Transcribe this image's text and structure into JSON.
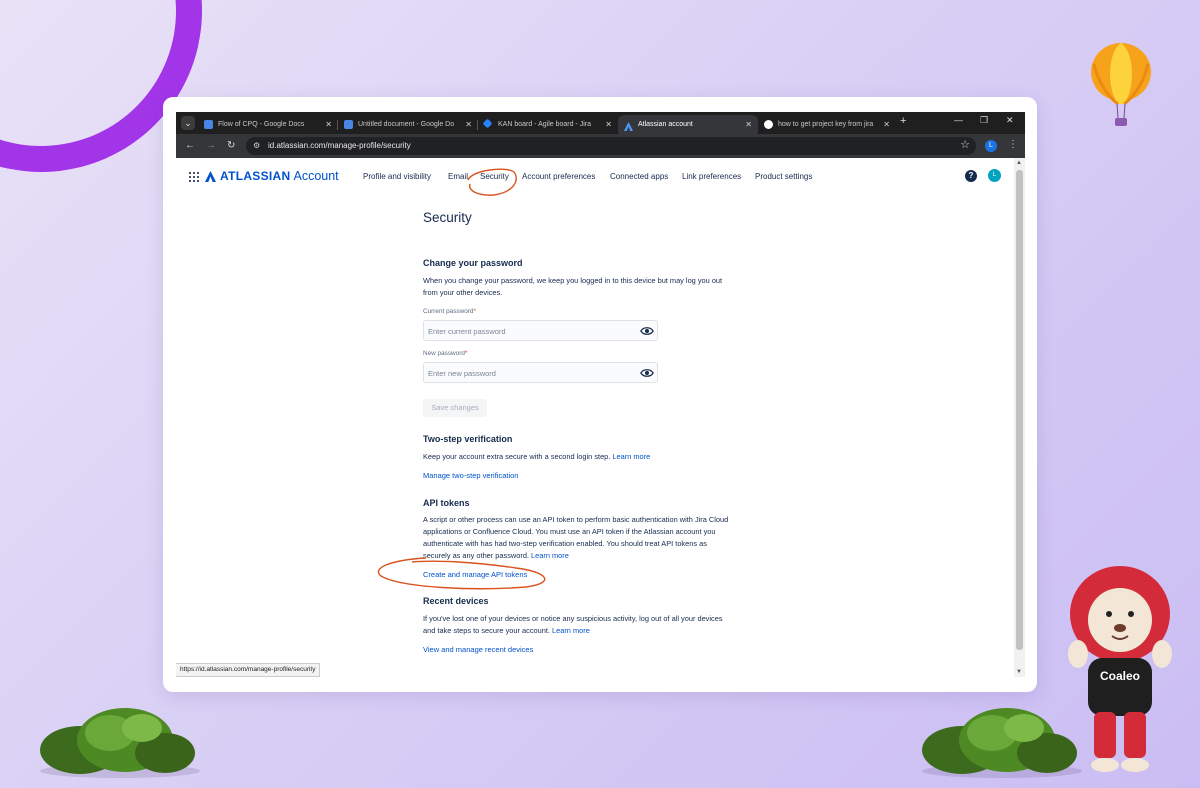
{
  "browser": {
    "tabs": [
      {
        "title": "Flow of CPQ - Google Docs",
        "icon": "google-docs-icon",
        "active": false
      },
      {
        "title": "Untitled document - Google Do",
        "icon": "google-docs-icon",
        "active": false
      },
      {
        "title": "KAN board - Agile board - Jira",
        "icon": "jira-icon",
        "active": false
      },
      {
        "title": "Atlassian account",
        "icon": "atlassian-icon",
        "active": true
      },
      {
        "title": "how to get project key from jira",
        "icon": "google-icon",
        "active": false
      }
    ],
    "url": "id.atlassian.com/manage-profile/security",
    "profile_initial": "L",
    "status_url": "https://id.atlassian.com/manage-profile/security"
  },
  "header": {
    "brand": "ATLASSIAN",
    "product": "Account",
    "nav": [
      "Profile and visibility",
      "Email",
      "Security",
      "Account preferences",
      "Connected apps",
      "Link preferences",
      "Product settings"
    ],
    "active_nav": "Security",
    "help": "?",
    "avatar_initial": "L"
  },
  "security": {
    "title": "Security",
    "password": {
      "heading": "Change your password",
      "desc_line1": "When you change your password, we keep you logged in to this device but may log you out",
      "desc_line2": "from your other devices.",
      "current_label": "Current password",
      "current_placeholder": "Enter current password",
      "new_label": "New password",
      "new_placeholder": "Enter new password",
      "required_mark": "*",
      "save_label": "Save changes"
    },
    "two_step": {
      "heading": "Two-step verification",
      "desc": "Keep your account extra secure with a second login step.",
      "learn_more": "Learn more",
      "manage_link": "Manage two-step verification"
    },
    "api_tokens": {
      "heading": "API tokens",
      "line1": "A script or other process can use an API token to perform basic authentication with Jira Cloud",
      "line2": "applications or Confluence Cloud. You must use an API token if the Atlassian account you",
      "line3": "authenticate with has had two-step verification enabled. You should treat API tokens as",
      "line4": "securely as any other password.",
      "learn_more": "Learn more",
      "manage_link": "Create and manage API tokens"
    },
    "recent_devices": {
      "heading": "Recent devices",
      "line1": "If you've lost one of your devices or notice any suspicious activity, log out of all your devices",
      "line2": "and take steps to secure your account.",
      "learn_more": "Learn more",
      "view_link": "View and manage recent devices"
    }
  },
  "decor": {
    "mascot_label": "Coaleo"
  },
  "colors": {
    "accent": "#0052cc",
    "annotation": "#d9531e",
    "purple_arc": "#a235e8"
  }
}
